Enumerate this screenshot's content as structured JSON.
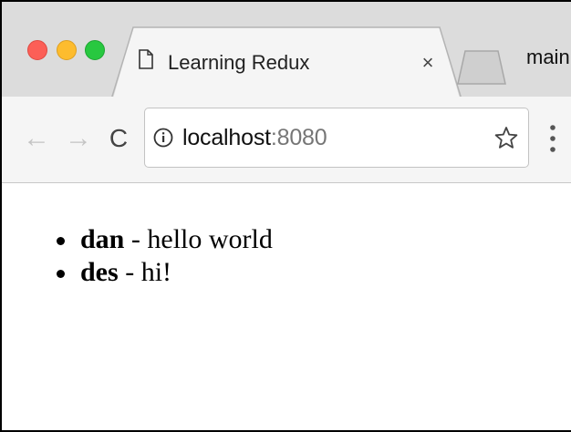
{
  "browser": {
    "tab": {
      "title": "Learning Redux",
      "close_glyph": "×",
      "icon": "document-icon"
    },
    "profile_label": "main",
    "nav": {
      "back_glyph": "←",
      "forward_glyph": "→",
      "reload_glyph": "C"
    },
    "address": {
      "host": "localhost",
      "port": ":8080"
    }
  },
  "page": {
    "messages": [
      {
        "user": "dan",
        "separator": " - ",
        "text": "hello world"
      },
      {
        "user": "des",
        "separator": " - ",
        "text": "hi!"
      }
    ]
  },
  "colors": {
    "traffic_red": "#fc5f57",
    "traffic_yellow": "#fdbc2e",
    "traffic_green": "#28c840",
    "port_text": "#767676"
  }
}
